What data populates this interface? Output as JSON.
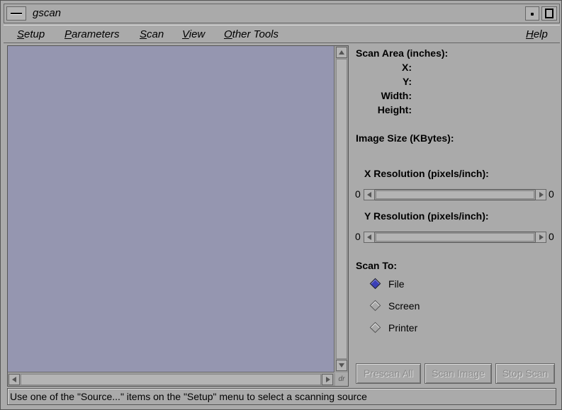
{
  "window": {
    "title": "gscan"
  },
  "menubar": {
    "items": [
      {
        "label": "Setup",
        "mnemonic": "S",
        "rest": "etup"
      },
      {
        "label": "Parameters",
        "mnemonic": "P",
        "rest": "arameters"
      },
      {
        "label": "Scan",
        "mnemonic": "S",
        "rest": "can"
      },
      {
        "label": "View",
        "mnemonic": "V",
        "rest": "iew"
      },
      {
        "label": "Other Tools",
        "mnemonic": "O",
        "rest": "ther Tools"
      },
      {
        "label": "Help",
        "mnemonic": "H",
        "rest": "elp"
      }
    ]
  },
  "canvas": {
    "corner_label": "dr",
    "background": "#9596b0"
  },
  "panel": {
    "scan_area_label": "Scan Area (inches):",
    "x_label": "X:",
    "y_label": "Y:",
    "width_label": "Width:",
    "height_label": "Height:",
    "image_size_label": "Image Size (KBytes):",
    "x_res_label": "X Resolution (pixels/inch):",
    "x_res_min": "0",
    "x_res_max": "0",
    "y_res_label": "Y Resolution (pixels/inch):",
    "y_res_min": "0",
    "y_res_max": "0",
    "scan_to_label": "Scan To:",
    "scan_to_options": [
      {
        "label": "File",
        "selected": true
      },
      {
        "label": "Screen",
        "selected": false
      },
      {
        "label": "Printer",
        "selected": false
      }
    ]
  },
  "buttons": {
    "prescan_all": "Prescan All",
    "scan_image": "Scan Image",
    "stop_scan": "Stop Scan"
  },
  "status": {
    "text": "Use one of the \"Source...\" items on the \"Setup\" menu to select a scanning source"
  },
  "colors": {
    "selected_radio": "#3a3fb8",
    "window_bg": "#aaaaaa"
  }
}
